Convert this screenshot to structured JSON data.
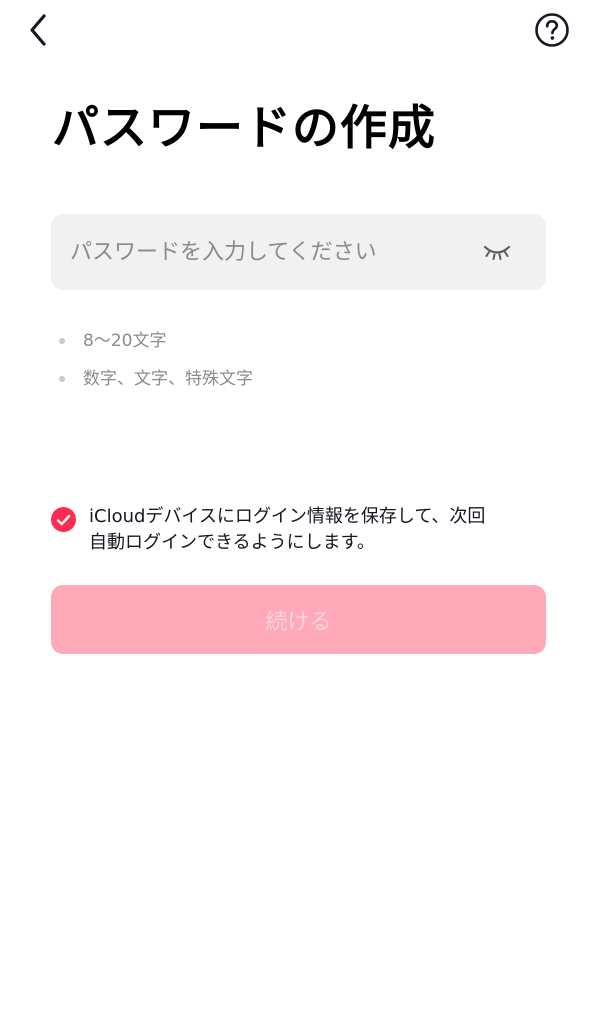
{
  "header": {
    "back_icon": "chevron-left-icon",
    "help_icon": "question-circle-icon"
  },
  "title": "パスワードの作成",
  "password_field": {
    "value": "",
    "placeholder": "パスワードを入力してください",
    "toggle_icon": "eye-closed-icon"
  },
  "rules": [
    {
      "text": "8〜20文字"
    },
    {
      "text": "数字、文字、特殊文字"
    }
  ],
  "icloud_option": {
    "checked": true,
    "line1": "iCloudデバイスにログイン情報を保存して、次回",
    "line2": "自動ログインできるようにします。"
  },
  "continue_button": {
    "label": "続ける",
    "enabled": false
  },
  "colors": {
    "accent": "#fe2c55",
    "button_disabled_bg": "#ffa9b9",
    "button_disabled_text": "#ffd6de",
    "field_bg": "#f1f1f2",
    "muted_text": "#8a8b91"
  }
}
